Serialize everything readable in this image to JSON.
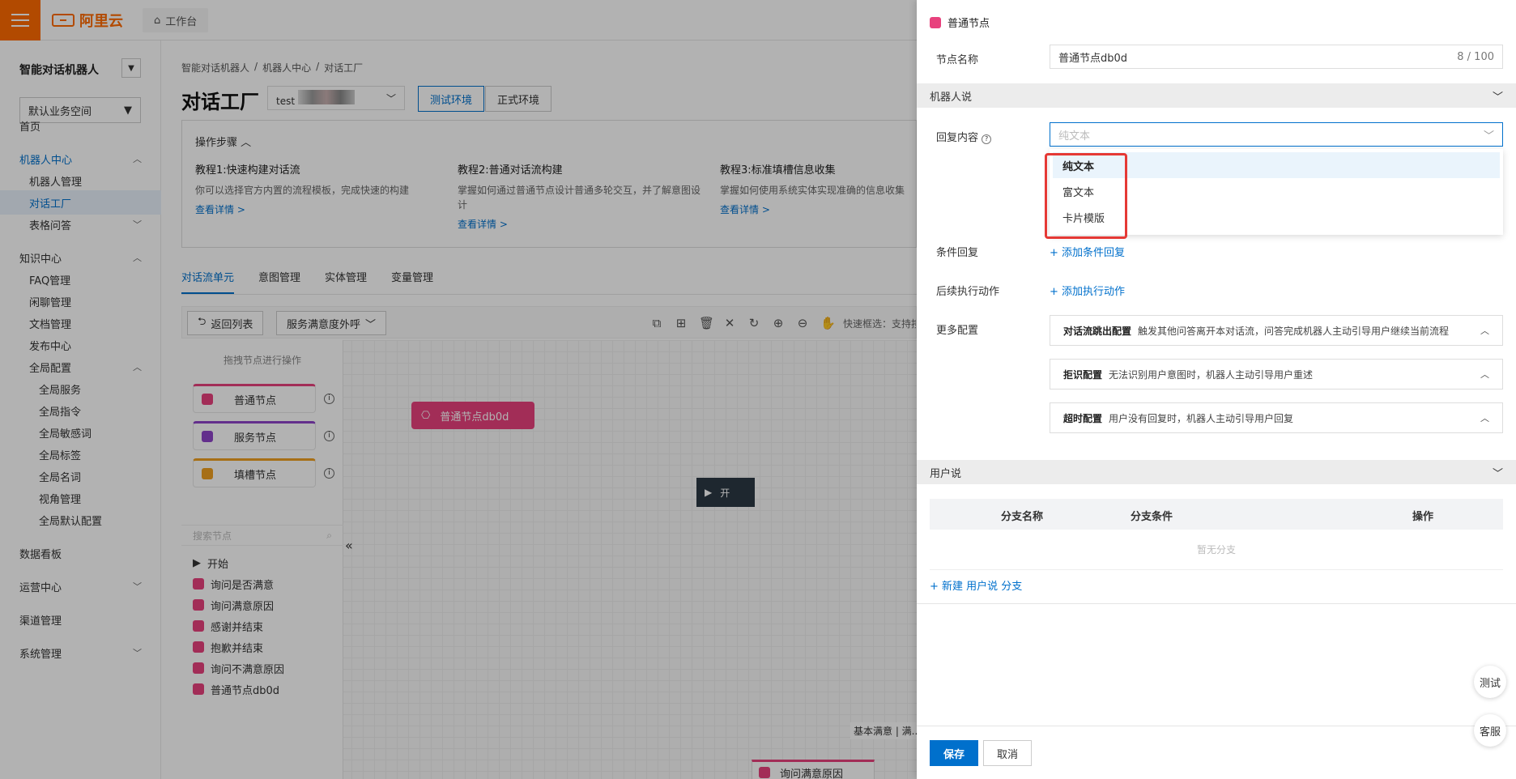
{
  "topbar": {
    "brand": "阿里云",
    "workspace": "工作台"
  },
  "sidebar": {
    "title": "智能对话机器人",
    "space": "默认业务空间",
    "items": [
      {
        "label": "首页"
      },
      {
        "label": "机器人中心"
      },
      {
        "label": "机器人管理"
      },
      {
        "label": "对话工厂"
      },
      {
        "label": "表格问答"
      },
      {
        "label": "知识中心"
      },
      {
        "label": "FAQ管理"
      },
      {
        "label": "闲聊管理"
      },
      {
        "label": "文档管理"
      },
      {
        "label": "发布中心"
      },
      {
        "label": "全局配置"
      },
      {
        "label": "全局服务"
      },
      {
        "label": "全局指令"
      },
      {
        "label": "全局敏感词"
      },
      {
        "label": "全局标签"
      },
      {
        "label": "全局名词"
      },
      {
        "label": "视角管理"
      },
      {
        "label": "全局默认配置"
      },
      {
        "label": "数据看板"
      },
      {
        "label": "运营中心"
      },
      {
        "label": "渠道管理"
      },
      {
        "label": "系统管理"
      }
    ]
  },
  "main": {
    "breadcrumb": [
      "智能对话机器人",
      "/",
      "机器人中心",
      "/",
      "对话工厂"
    ],
    "title": "对话工厂",
    "bot_select": "test",
    "env_test": "测试环境",
    "env_prod": "正式环境",
    "steps_header": "操作步骤",
    "steps": [
      {
        "title": "教程1:快速构建对话流",
        "desc": "你可以选择官方内置的流程模板，完成快速的构建",
        "link": "查看详情 >"
      },
      {
        "title": "教程2:普通对话流构建",
        "desc": "掌握如何通过普通节点设计普通多轮交互，并了解意图设计",
        "link": "查看详情 >"
      },
      {
        "title": "教程3:标准填槽信息收集",
        "desc": "掌握如何使用系统实体实现准确的信息收集",
        "link": "查看详情 >"
      }
    ],
    "tabs": [
      "对话流单元",
      "意图管理",
      "实体管理",
      "变量管理"
    ],
    "back_btn": "返回列表",
    "flow_select": "服务满意度外呼",
    "quick_hint": "快速框选：支持按住shift",
    "palette_hint": "拖拽节点进行操作",
    "palette_nodes": [
      "普通节点",
      "服务节点",
      "填槽节点"
    ],
    "search_placeholder": "搜索节点",
    "tree": [
      "开始",
      "询问是否满意",
      "询问满意原因",
      "感谢并结束",
      "抱歉并结束",
      "询问不满意原因",
      "普通节点db0d"
    ],
    "canvas_node": "普通节点db0d",
    "start_node": "开",
    "edge_label": "基本满意 | 满...",
    "bottom_node": "询问满意原因"
  },
  "panel": {
    "header": "普通节点",
    "name_label": "节点名称",
    "name_value": "普通节点db0d",
    "name_count": "8 / 100",
    "robot_says": "机器人说",
    "reply_label": "回复内容",
    "reply_placeholder": "纯文本",
    "reply_options": [
      "纯文本",
      "富文本",
      "卡片模版"
    ],
    "cond_label": "条件回复",
    "cond_link": "+ 添加条件回复",
    "action_label": "后续执行动作",
    "action_link": "+ 添加执行动作",
    "more_label": "更多配置",
    "configs": [
      {
        "title": "对话流跳出配置",
        "desc": "触发其他问答离开本对话流，问答完成机器人主动引导用户继续当前流程"
      },
      {
        "title": "拒识配置",
        "desc": "无法识别用户意图时，机器人主动引导用户重述"
      },
      {
        "title": "超时配置",
        "desc": "用户没有回复时，机器人主动引导用户回复"
      }
    ],
    "user_says": "用户说",
    "table_headers": [
      "分支名称",
      "分支条件",
      "操作"
    ],
    "empty_text": "暂无分支",
    "new_branch": "+ 新建 用户说 分支",
    "save": "保存",
    "cancel": "取消"
  },
  "fab": {
    "test": "测试",
    "service": "客服"
  },
  "colors": {
    "brand": "#ff6a00",
    "accent": "#0070cc",
    "node": "#e8417d",
    "highlight": "#e53935"
  }
}
